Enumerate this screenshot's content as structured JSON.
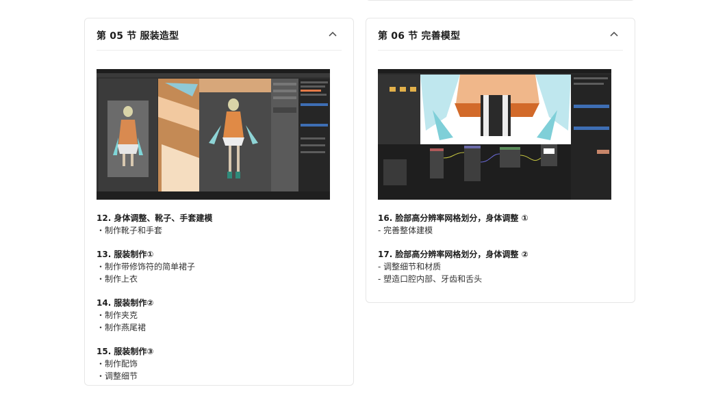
{
  "sections": [
    {
      "title": "第 05 节 服装造型",
      "items": [
        {
          "title": "12. 身体调整、靴子、手套建模",
          "lines": [
            "・制作靴子和手套"
          ]
        },
        {
          "title": "13. 服装制作①",
          "lines": [
            "・制作带修饰符的简单裙子",
            "・制作上衣"
          ]
        },
        {
          "title": "14. 服装制作②",
          "lines": [
            "・制作夹克",
            "・制作燕尾裙"
          ]
        },
        {
          "title": "15. 服装制作③",
          "lines": [
            "・制作配饰",
            "・调整细节"
          ]
        }
      ]
    },
    {
      "title": "第 06 节 完善模型",
      "items": [
        {
          "title": "16. 脸部高分辨率网格划分，身体调整 ①",
          "lines": [
            "- 完善整体建模"
          ]
        },
        {
          "title": "17. 脸部高分辨率网格划分，身体调整 ②",
          "lines": [
            "- 调整细节和材质",
            "- 塑造口腔内部、牙齿和舌头"
          ]
        }
      ]
    }
  ],
  "icons": {
    "collapse": "chevron-up-icon"
  },
  "colors": {
    "border": "#e6e6e6",
    "text": "#222222",
    "app_bg": "#2a2a2a"
  }
}
